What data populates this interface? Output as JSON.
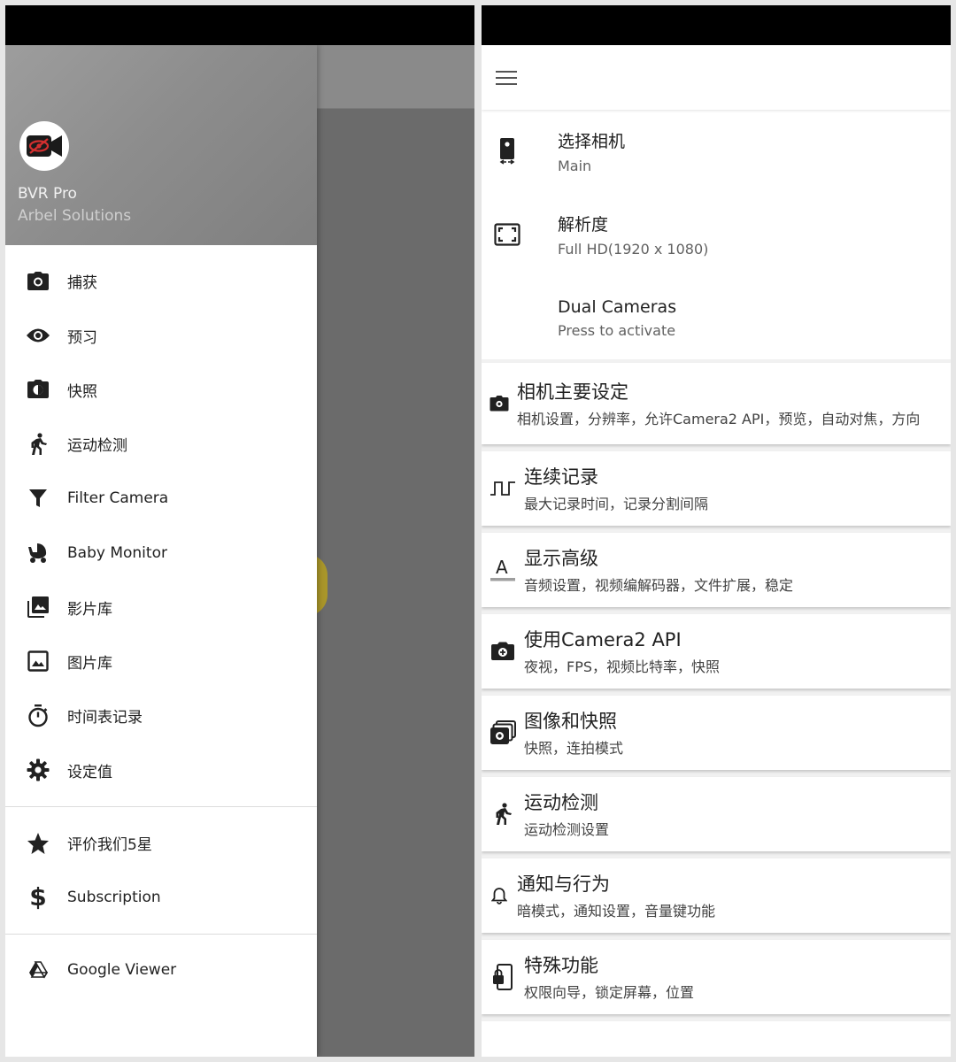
{
  "drawer": {
    "app_name": "BVR Pro",
    "company": "Arbel Solutions",
    "items": [
      {
        "label": "捕获",
        "icon": "camera-icon"
      },
      {
        "label": "预习",
        "icon": "eye-icon"
      },
      {
        "label": "快照",
        "icon": "snapshot-icon"
      },
      {
        "label": "运动检测",
        "icon": "running-person-icon"
      },
      {
        "label": "Filter Camera",
        "icon": "filter-icon"
      },
      {
        "label": "Baby Monitor",
        "icon": "stroller-icon"
      },
      {
        "label": "影片库",
        "icon": "photo-library-icon"
      },
      {
        "label": "图片库",
        "icon": "image-icon"
      },
      {
        "label": "时间表记录",
        "icon": "timer-icon"
      },
      {
        "label": "设定值",
        "icon": "gear-icon"
      }
    ],
    "items2": [
      {
        "label": "评价我们5星",
        "icon": "star-icon"
      },
      {
        "label": "Subscription",
        "icon": "dollar-icon"
      }
    ],
    "items3": [
      {
        "label": "Google Viewer",
        "icon": "drive-icon"
      }
    ]
  },
  "settings": {
    "top": [
      {
        "title": "选择相机",
        "sub": "Main",
        "icon": "phone-camera-icon"
      },
      {
        "title": "解析度",
        "sub": "Full HD(1920 x 1080)",
        "icon": "resolution-icon"
      },
      {
        "title": "Dual Cameras",
        "sub": "Press to activate",
        "icon": ""
      }
    ],
    "cards": [
      {
        "title": "相机主要设定",
        "sub": "相机设置，分辨率，允许Camera2 API，预览，自动对焦，方向",
        "icon": "camera-settings-icon"
      },
      {
        "title": "连续记录",
        "sub": "最大记录时间，记录分割间隔",
        "icon": "pulse-icon"
      },
      {
        "title": "显示高级",
        "sub": "音频设置，视频编解码器，文件扩展，稳定",
        "icon": "text-format-icon"
      },
      {
        "title": "使用Camera2 API",
        "sub": "夜视，FPS，视频比特率，快照",
        "icon": "camera-plus-icon"
      },
      {
        "title": "图像和快照",
        "sub": "快照，连拍模式",
        "icon": "photo-stack-icon"
      },
      {
        "title": "运动检测",
        "sub": "运动检测设置",
        "icon": "running-person-icon"
      },
      {
        "title": "通知与行为",
        "sub": "暗模式，通知设置，音量键功能",
        "icon": "bell-icon"
      },
      {
        "title": "特殊功能",
        "sub": "权限向导，锁定屏幕，位置",
        "icon": "phone-lock-icon"
      }
    ]
  }
}
